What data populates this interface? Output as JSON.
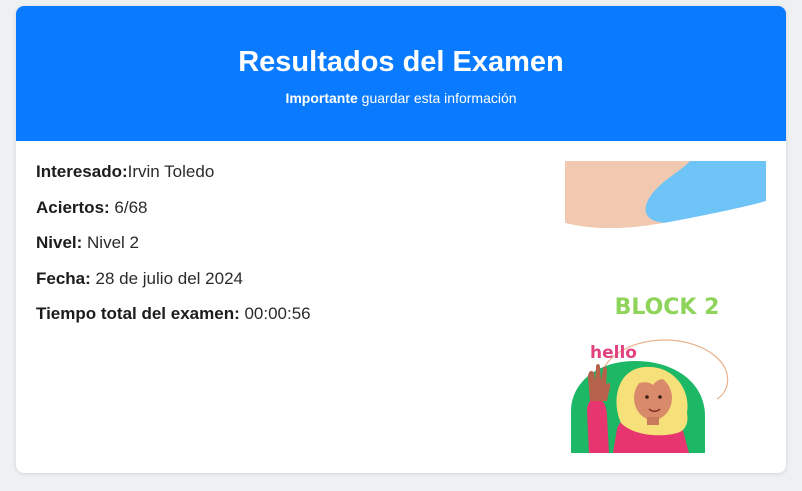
{
  "header": {
    "title": "Resultados del Examen",
    "subtitle_strong": "Importante",
    "subtitle_rest": " guardar esta información"
  },
  "results": {
    "interesado_label": "Interesado:",
    "interesado_value": "Irvin Toledo",
    "aciertos_label": "Aciertos:",
    "aciertos_value": " 6/68",
    "nivel_label": "Nivel:",
    "nivel_value": " Nivel 2",
    "fecha_label": "Fecha:",
    "fecha_value": " 28 de julio del 2024",
    "tiempo_label": "Tiempo total del examen:",
    "tiempo_value": " 00:00:56"
  },
  "illustration": {
    "block_text": "BLOCK 2",
    "hello_text": "hello"
  },
  "colors": {
    "header_bg": "#0a7bff",
    "block_green": "#8ed45a",
    "hello_pink": "#e0417f",
    "sky_blue": "#6ec3f7",
    "peach": "#f0c9b0",
    "circle_green": "#1db866",
    "shirt_pink": "#e6356f",
    "hair_yellow": "#f6e07a"
  }
}
